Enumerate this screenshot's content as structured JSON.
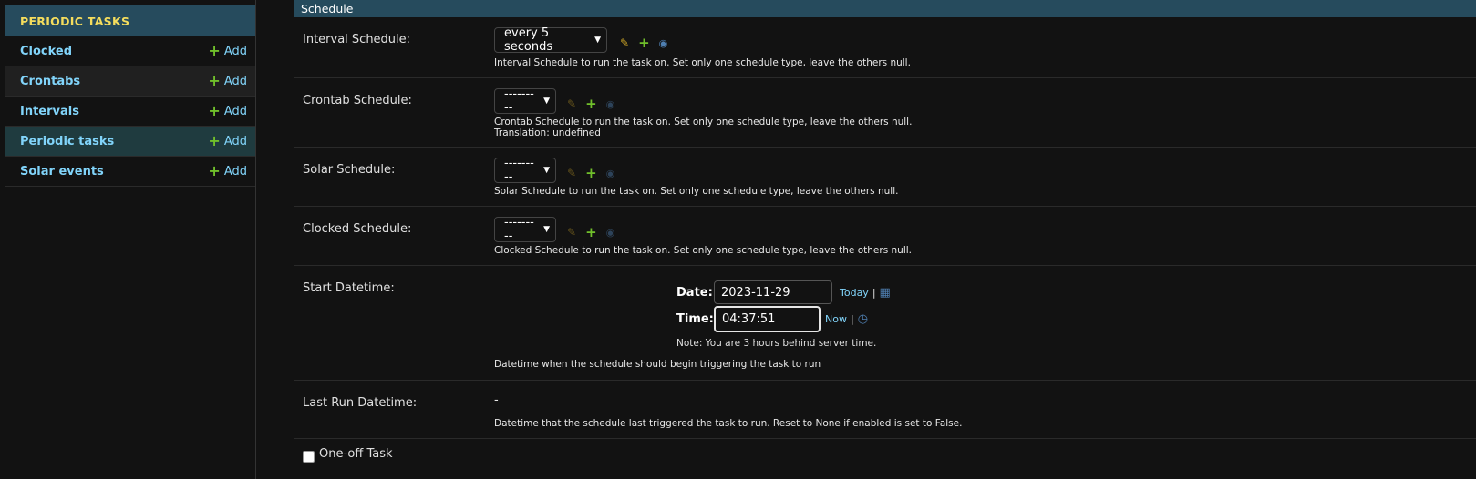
{
  "sidebar": {
    "header": "PERIODIC TASKS",
    "add_label": "Add",
    "items": [
      {
        "label": "Clocked"
      },
      {
        "label": "Crontabs"
      },
      {
        "label": "Intervals"
      },
      {
        "label": "Periodic tasks"
      },
      {
        "label": "Solar events"
      }
    ]
  },
  "main": {
    "section_title": "Schedule",
    "interval": {
      "label": "Interval Schedule:",
      "value": "every 5 seconds",
      "help": "Interval Schedule to run the task on. Set only one schedule type, leave the others null."
    },
    "crontab": {
      "label": "Crontab Schedule:",
      "value": "---------",
      "help": "Crontab Schedule to run the task on. Set only one schedule type, leave the others null.",
      "help2": "Translation: undefined"
    },
    "solar": {
      "label": "Solar Schedule:",
      "value": "---------",
      "help": "Solar Schedule to run the task on. Set only one schedule type, leave the others null."
    },
    "clocked": {
      "label": "Clocked Schedule:",
      "value": "---------",
      "help": "Clocked Schedule to run the task on. Set only one schedule type, leave the others null."
    },
    "start_datetime": {
      "label": "Start Datetime:",
      "date_label": "Date:",
      "date_value": "2023-11-29",
      "today_link": "Today",
      "time_label": "Time:",
      "time_value": "04:37:51",
      "now_link": "Now",
      "separator": "|",
      "note": "Note: You are 3 hours behind server time.",
      "help": "Datetime when the schedule should begin triggering the task to run"
    },
    "last_run": {
      "label": "Last Run Datetime:",
      "value": "-",
      "help": "Datetime that the schedule last triggered the task to run. Reset to None if enabled is set to False."
    },
    "one_off": {
      "label": "One-off Task"
    }
  },
  "colors": {
    "header_bg": "#264b5d",
    "link": "#81d4fa",
    "sidebar_header_text": "#f5dd5d",
    "add_green": "#70bf2b"
  }
}
